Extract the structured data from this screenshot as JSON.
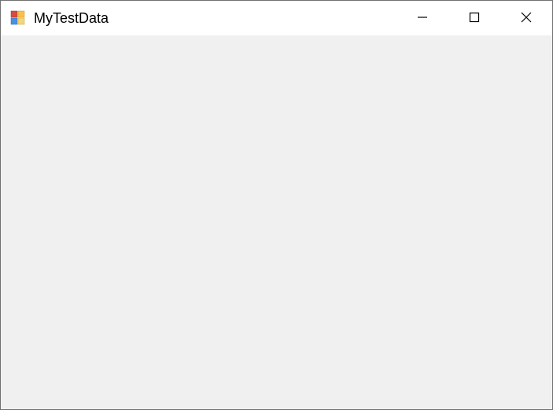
{
  "window": {
    "title": "MyTestData"
  }
}
